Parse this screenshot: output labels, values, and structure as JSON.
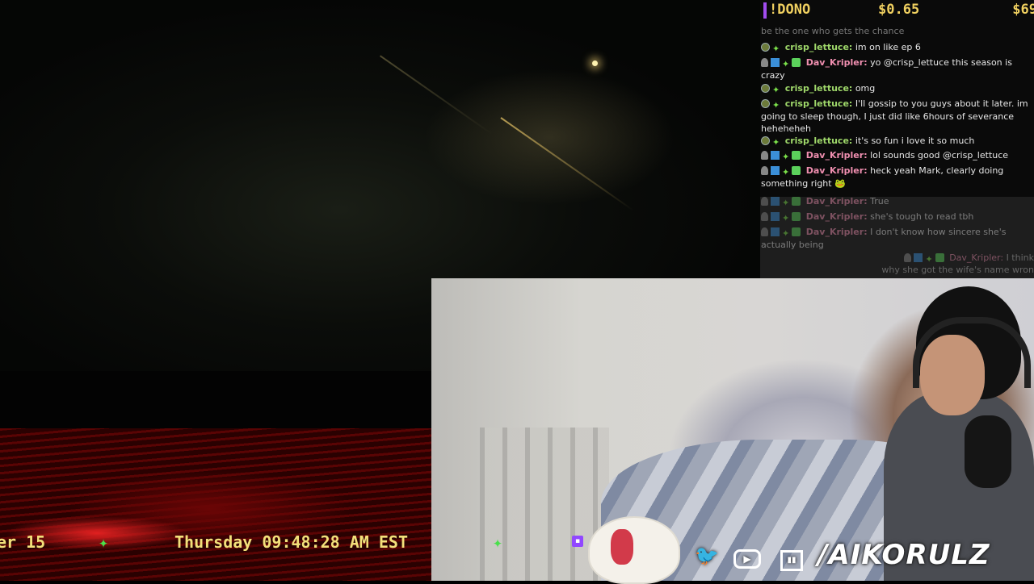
{
  "dono_bar": {
    "command": "!DONO",
    "amount_raised": "$0.65",
    "goal": "$69"
  },
  "chat": {
    "faded_top": "be the one who gets the chance",
    "messages": [
      {
        "user": "crisp_lettuce:",
        "text": "im on like ep 6"
      },
      {
        "user": "Dav_Kripler:",
        "text": "yo @crisp_lettuce this season is crazy"
      },
      {
        "user": "crisp_lettuce:",
        "text": "omg"
      },
      {
        "user": "crisp_lettuce:",
        "text": "I'll gossip to you guys about it later. im going to sleep though, I just did like 6hours of severance heheheheh"
      },
      {
        "user": "crisp_lettuce:",
        "text": "it's so fun i love it so much"
      },
      {
        "user": "Dav_Kripler:",
        "text": "lol sounds good @crisp_lettuce"
      },
      {
        "user": "Dav_Kripler:",
        "text": "heck yeah Mark, clearly doing something right"
      },
      {
        "user": "Dav_Kripler:",
        "text": "True"
      },
      {
        "user": "Dav_Kripler:",
        "text": "she's tough to read tbh"
      },
      {
        "user": "Dav_Kripler:",
        "text": "I don't know how sincere she's actually being"
      }
    ],
    "overlay_message": {
      "user": "Dav_Kripler:",
      "text": "I think",
      "line2": "why she got the wife's name wron"
    }
  },
  "ticker": {
    "date": "er 15",
    "day_time": "Thursday 09:48:28 AM EST"
  },
  "social": {
    "twitter_icon": "twitter-icon",
    "youtube_icon": "youtube-icon",
    "twitch_icon": "twitch-icon",
    "handle": "/AIKORULZ"
  },
  "colors": {
    "ticker_text": "#f2e07a",
    "sparkle": "#48e04a",
    "dono_text": "#f0d060",
    "dono_bar": "#a24df0",
    "user_green": "#9fd86a",
    "user_pink": "#f08fb0"
  }
}
